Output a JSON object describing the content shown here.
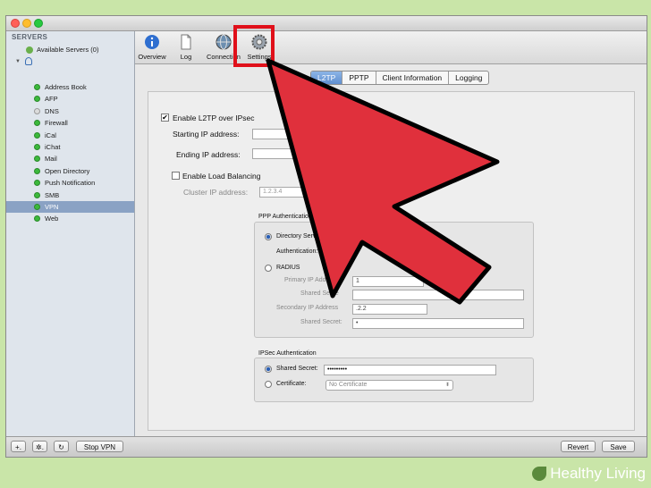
{
  "sidebar": {
    "header": "SERVERS",
    "available": "Available Servers (0)",
    "services": [
      {
        "label": "Address Book",
        "status": "on"
      },
      {
        "label": "AFP",
        "status": "on"
      },
      {
        "label": "DNS",
        "status": "off"
      },
      {
        "label": "Firewall",
        "status": "on"
      },
      {
        "label": "iCal",
        "status": "on"
      },
      {
        "label": "iChat",
        "status": "on"
      },
      {
        "label": "Mail",
        "status": "on"
      },
      {
        "label": "Open Directory",
        "status": "on"
      },
      {
        "label": "Push Notification",
        "status": "on"
      },
      {
        "label": "SMB",
        "status": "on"
      },
      {
        "label": "VPN",
        "status": "on",
        "selected": true
      },
      {
        "label": "Web",
        "status": "on"
      }
    ]
  },
  "toolbar": {
    "overview": "Overview",
    "log": "Log",
    "connections": "Connection",
    "settings": "Settings"
  },
  "tabs": [
    "L2TP",
    "PPTP",
    "Client Information",
    "Logging"
  ],
  "l2tp": {
    "enable_label": "Enable L2TP over IPsec",
    "enabled": true,
    "start_ip_label": "Starting IP address:",
    "start_ip_value": "",
    "end_ip_label": "Ending IP address:",
    "end_ip_value": "",
    "load_balancing_label": "Enable Load Balancing",
    "load_balancing": false,
    "cluster_ip_label": "Cluster IP address:",
    "cluster_ip_value": "1.2.3.4"
  },
  "ppp": {
    "legend": "PPP Authentication",
    "directory_label": "Directory Servi",
    "authentication_label": "Authentication:",
    "radius_label": "RADIUS",
    "primary_label": "Primary IP Addre",
    "primary_value": "1",
    "shared1_label": "Shared Secre",
    "shared1_value": "",
    "secondary_label": "Secondary IP Address",
    "secondary_value": ".2.2",
    "shared2_label": "Shared Secret:",
    "shared2_value": "•"
  },
  "ipsec": {
    "legend": "IPSec Authentication",
    "shared_label": "Shared Secret:",
    "shared_value": "•••••••••",
    "cert_label": "Certificate:",
    "cert_value": "No Certificate"
  },
  "bottom": {
    "add": "+.",
    "gear": "✲.",
    "refresh": "↻",
    "stop_vpn": "Stop VPN",
    "revert": "Revert",
    "save": "Save"
  },
  "watermark": {
    "text": "Healthy Living"
  },
  "colors": {
    "highlight_box": "#e0101a",
    "arrow_fill": "#e0303c",
    "selection": "#8aa2c4"
  }
}
